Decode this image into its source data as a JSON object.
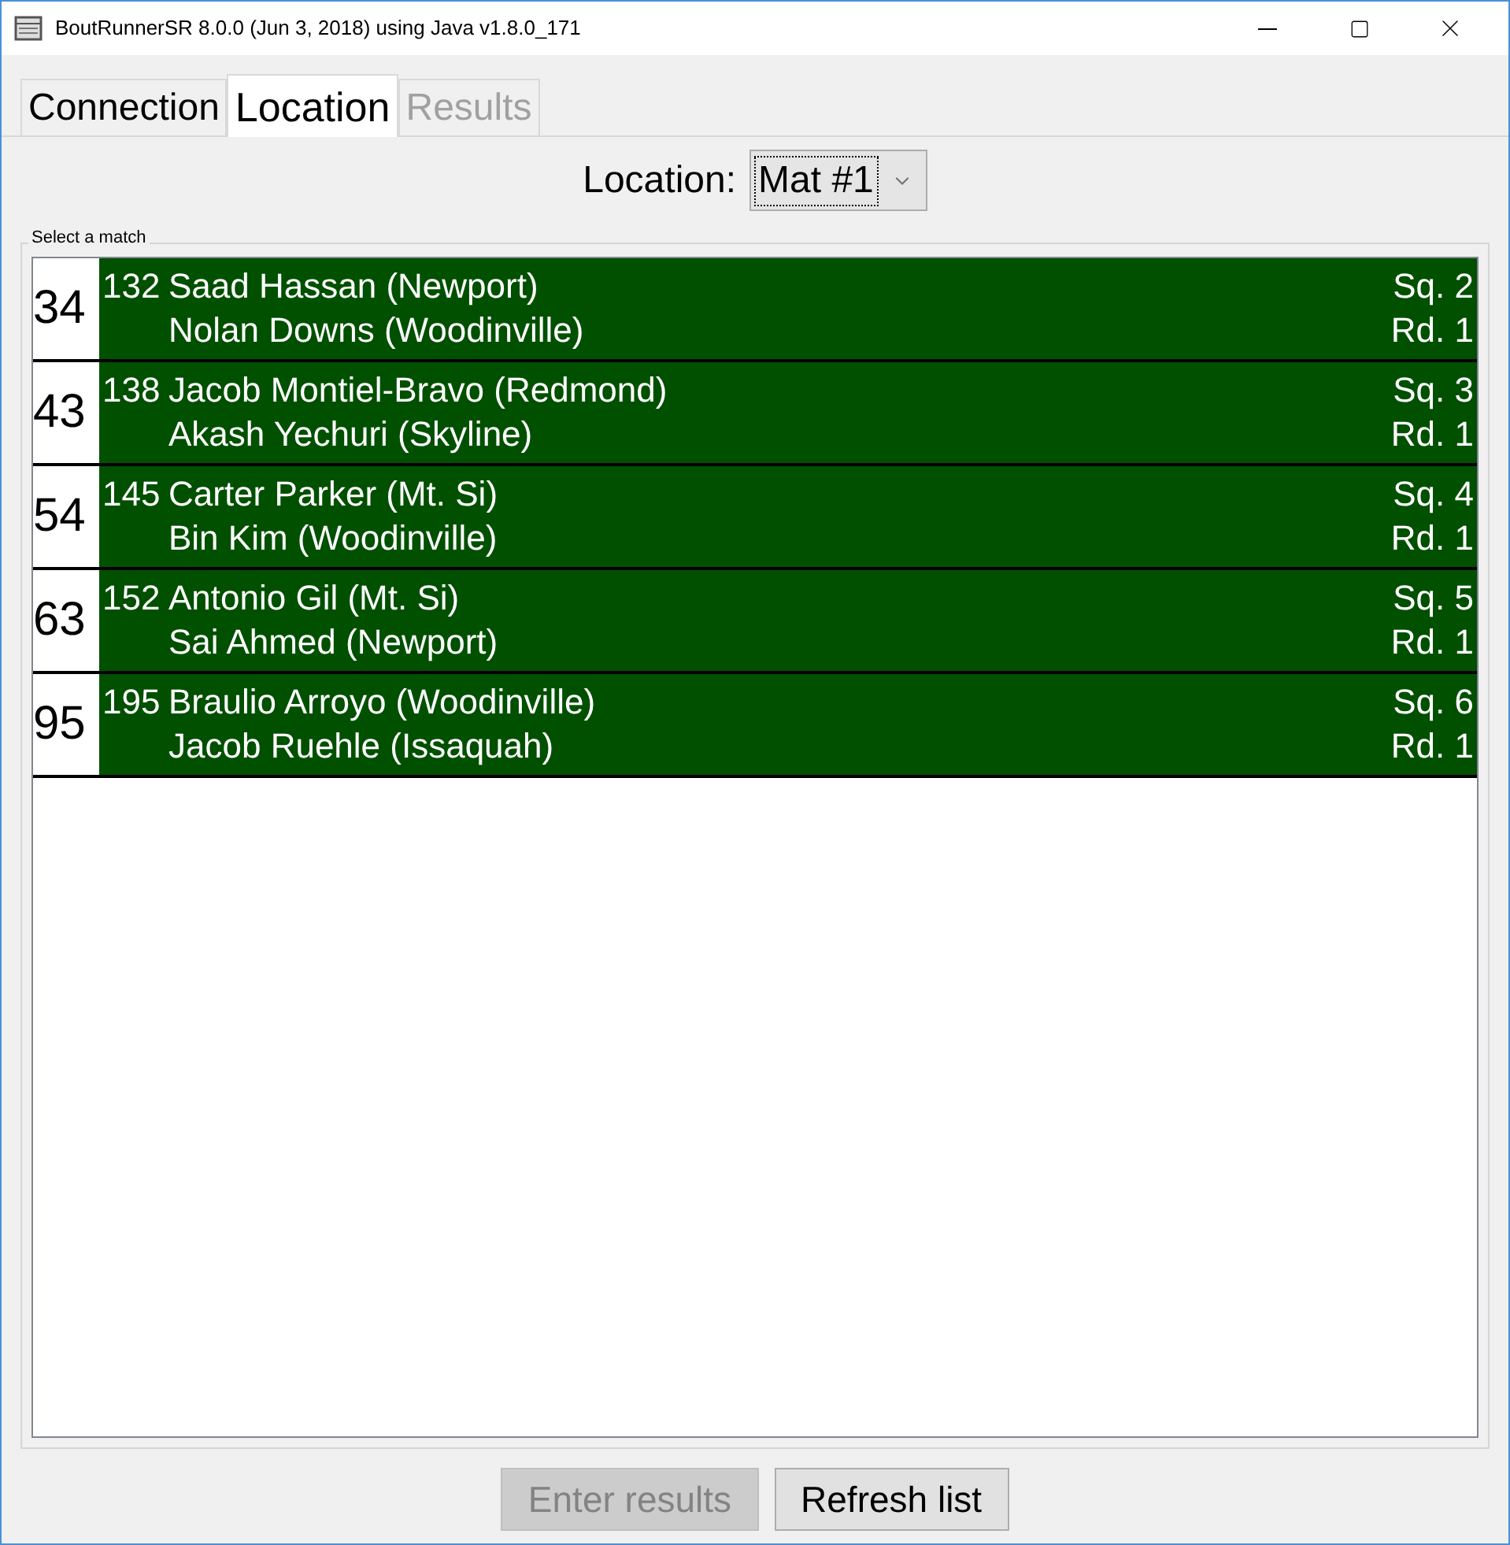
{
  "window": {
    "title": "BoutRunnerSR 8.0.0 (Jun 3, 2018) using Java v1.8.0_171"
  },
  "tabs": [
    {
      "label": "Connection",
      "selected": false,
      "disabled": false
    },
    {
      "label": "Location",
      "selected": true,
      "disabled": false
    },
    {
      "label": "Results",
      "selected": false,
      "disabled": true
    }
  ],
  "location": {
    "label": "Location:",
    "value": "Mat #1"
  },
  "match_list": {
    "title": "Select a match",
    "rows": [
      {
        "number": "34",
        "weight": "132",
        "top": "Saad Hassan (Newport)",
        "bottom": "Nolan Downs (Woodinville)",
        "sequence": "Sq. 2",
        "round": "Rd. 1"
      },
      {
        "number": "43",
        "weight": "138",
        "top": "Jacob Montiel-Bravo (Redmond)",
        "bottom": "Akash Yechuri (Skyline)",
        "sequence": "Sq. 3",
        "round": "Rd. 1"
      },
      {
        "number": "54",
        "weight": "145",
        "top": "Carter Parker (Mt. Si)",
        "bottom": "Bin Kim (Woodinville)",
        "sequence": "Sq. 4",
        "round": "Rd. 1"
      },
      {
        "number": "63",
        "weight": "152",
        "top": "Antonio Gil (Mt. Si)",
        "bottom": "Sai Ahmed (Newport)",
        "sequence": "Sq. 5",
        "round": "Rd. 1"
      },
      {
        "number": "95",
        "weight": "195",
        "top": "Braulio Arroyo (Woodinville)",
        "bottom": "Jacob Ruehle (Issaquah)",
        "sequence": "Sq. 6",
        "round": "Rd. 1"
      }
    ]
  },
  "buttons": [
    {
      "label": "Enter results",
      "disabled": true
    },
    {
      "label": "Refresh list",
      "disabled": false
    }
  ]
}
